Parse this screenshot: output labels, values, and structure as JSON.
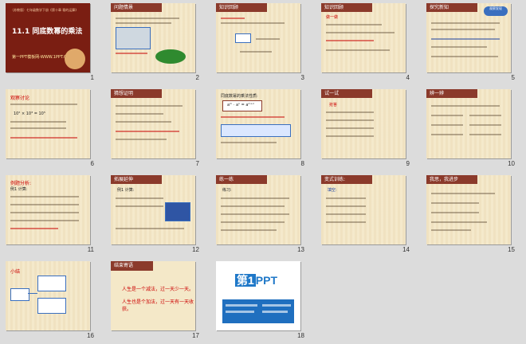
{
  "slides": [
    {
      "number": "1",
      "title": "11.1 同底数幂的乘法",
      "subtitle": "第一PPT模板网-WWW.1PPT.COM",
      "top_note": "（苏教版）七年级数学下册《第十章 幂的运算》"
    },
    {
      "number": "2",
      "title": "问题情景"
    },
    {
      "number": "3",
      "title": "知识回顾"
    },
    {
      "number": "4",
      "title": "知识回顾",
      "badge": "做一做"
    },
    {
      "number": "5",
      "title": "探究新知",
      "badge": "观察发现"
    },
    {
      "number": "6",
      "title": "观察讨论",
      "formula": "10² × 10³ = 10⁵"
    },
    {
      "number": "7",
      "title": "猜想证明"
    },
    {
      "number": "8",
      "title": "同底数幂的乘法性质:",
      "formula": "aᵐ · aⁿ = aᵐ⁺ⁿ"
    },
    {
      "number": "9",
      "title": "试一试",
      "badge": "抢答"
    },
    {
      "number": "10",
      "title": "辨一辨"
    },
    {
      "number": "11",
      "title": "例题分析:",
      "line2": "例1 计算:"
    },
    {
      "number": "12",
      "title": "拓展延伸",
      "line2": "例1 计算:"
    },
    {
      "number": "13",
      "title": "练一练",
      "line2": "练习:"
    },
    {
      "number": "14",
      "title": "变式训练:",
      "line2": "填空:"
    },
    {
      "number": "15",
      "title": "我思，我进步"
    },
    {
      "number": "16",
      "title": "小结"
    },
    {
      "number": "17",
      "title": "结束寄语",
      "line1": "人生是一个减法，过一天少一天。",
      "line2": "人生也是个加法，过一天有一天收获。"
    },
    {
      "number": "18",
      "logo": "PPT",
      "logo_num": "第1"
    }
  ]
}
